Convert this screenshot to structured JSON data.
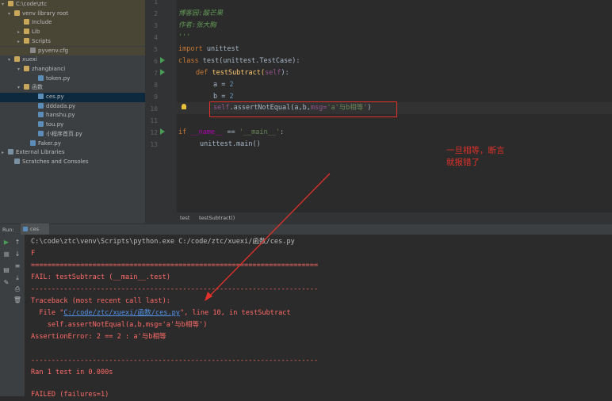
{
  "tree": {
    "rows": [
      {
        "label": "C:\\code\\ztc",
        "indent": 2,
        "arrow": "▾",
        "icon": "folder",
        "venv": true
      },
      {
        "label": "venv  library root",
        "indent": 10,
        "arrow": "▾",
        "icon": "folder",
        "venv": true
      },
      {
        "label": "Include",
        "indent": 22,
        "arrow": "",
        "icon": "folder",
        "venv": true
      },
      {
        "label": "Lib",
        "indent": 22,
        "arrow": "▸",
        "icon": "folder",
        "venv": true
      },
      {
        "label": "Scripts",
        "indent": 22,
        "arrow": "▸",
        "icon": "folder",
        "venv": true
      },
      {
        "label": "pyvenv.cfg",
        "indent": 30,
        "arrow": "",
        "icon": "cfg",
        "venv": true
      },
      {
        "label": "xuexi",
        "indent": 10,
        "arrow": "▾",
        "icon": "folder"
      },
      {
        "label": "zhangbianci",
        "indent": 22,
        "arrow": "▾",
        "icon": "folder"
      },
      {
        "label": "token.py",
        "indent": 40,
        "arrow": "",
        "icon": "py"
      },
      {
        "label": "函数",
        "indent": 22,
        "arrow": "▾",
        "icon": "folder"
      },
      {
        "label": "ces.py",
        "indent": 40,
        "arrow": "",
        "icon": "py",
        "selected": true
      },
      {
        "label": "dddada.py",
        "indent": 40,
        "arrow": "",
        "icon": "py"
      },
      {
        "label": "hanshu.py",
        "indent": 40,
        "arrow": "",
        "icon": "py"
      },
      {
        "label": "tou.py",
        "indent": 40,
        "arrow": "",
        "icon": "py"
      },
      {
        "label": "小程序首页.py",
        "indent": 40,
        "arrow": "",
        "icon": "py"
      },
      {
        "label": "Faker.py",
        "indent": 30,
        "arrow": "",
        "icon": "py"
      },
      {
        "label": "External Libraries",
        "indent": 2,
        "arrow": "▸",
        "icon": "lib"
      },
      {
        "label": "Scratches and Consoles",
        "indent": 10,
        "arrow": "",
        "icon": "lib"
      }
    ]
  },
  "editor": {
    "line_numbers": [
      "1",
      "2",
      "3",
      "4",
      "5",
      "6",
      "7",
      "8",
      "9",
      "10",
      "11",
      "12",
      "13"
    ],
    "lines": {
      "l1": "'''",
      "l2": "博客园:酸芒果",
      "l3": "作者:张大胸",
      "l4": "'''",
      "l5_kw": "import",
      "l5_rest": " unittest",
      "l6_kw": "class",
      "l6_rest": " test(unittest.TestCase):",
      "l7_kw": "def",
      "l7_name": " testSubtract(",
      "l7_self": "self",
      "l7_end": "):",
      "l8_var": "a = ",
      "l8_num": "2",
      "l9_var": "b = ",
      "l9_num": "2",
      "l10_self": "self",
      "l10_call": ".assertNotEqual(a,b,",
      "l10_kw": "msg=",
      "l10_str": "'a'与b相等'",
      "l10_end": ")",
      "l12_kw": "if",
      "l12_dunder": " __name__ ",
      "l12_mid": "== ",
      "l12_str": "'__main__'",
      "l12_end": ":",
      "l13": "unittest.main()"
    },
    "breadcrumb": [
      "test",
      "testSubtract()"
    ]
  },
  "annotation": {
    "line1": "一旦相等，断言",
    "line2": "就报错了"
  },
  "run_panel": {
    "label": "Run:",
    "tab": "ces"
  },
  "console": {
    "cmd": "C:\\code\\ztc\\venv\\Scripts\\python.exe C:/code/ztc/xuexi/函数/ces.py",
    "f": "F",
    "sep_eq": "======================================================================",
    "fail": "FAIL: testSubtract (__main__.test)",
    "sep_dash": "----------------------------------------------------------------------",
    "tb": "Traceback (most recent call last):",
    "file_pre": "  File \"",
    "file_link": "C:/code/ztc/xuexi/函数/ces.py",
    "file_post": "\", line 10, in testSubtract",
    "code": "    self.assertNotEqual(a,b,msg='a'与b相等')",
    "err": "AssertionError: 2 == 2 : a'与b相等",
    "sep_dash2": "----------------------------------------------------------------------",
    "ran": "Ran 1 test in 0.000s",
    "failed": "FAILED (failures=1)"
  },
  "colors": {
    "annotation_red": "#e0312b",
    "console_red": "#ff6b68",
    "link_blue": "#5394ec"
  }
}
